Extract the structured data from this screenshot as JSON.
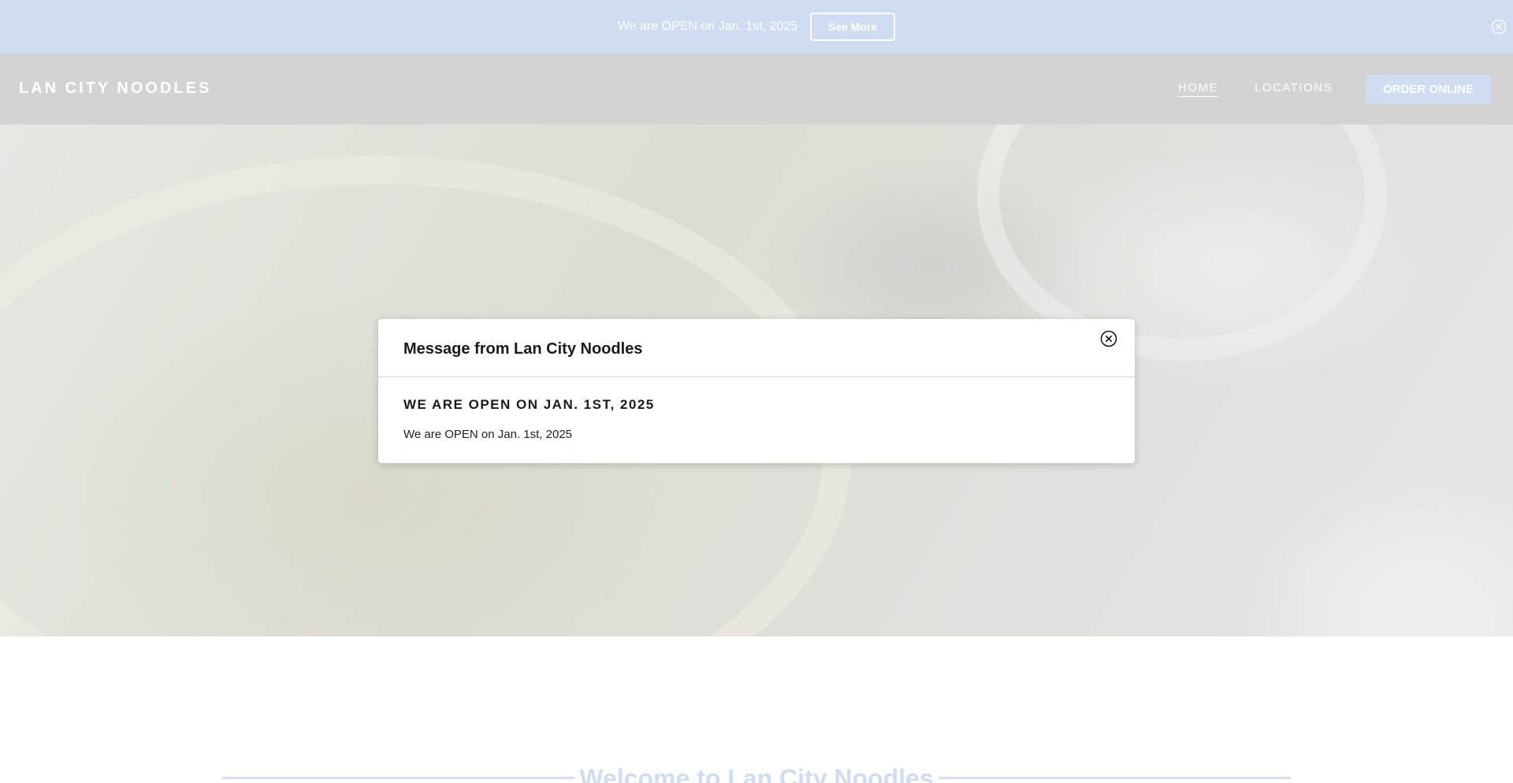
{
  "announcement": {
    "text": "We are OPEN on Jan. 1st, 2025",
    "button_label": "See More",
    "close_icon": "close-circle-icon"
  },
  "header": {
    "brand": "LAN CITY NOODLES",
    "nav": [
      {
        "label": "HOME",
        "active": true
      },
      {
        "label": "LOCATIONS",
        "active": false
      }
    ],
    "order_label": "ORDER ONLINE"
  },
  "modal": {
    "title": "Message from Lan City Noodles",
    "heading": "WE ARE OPEN ON JAN. 1ST, 2025",
    "body": "We are OPEN on Jan. 1st, 2025",
    "close_icon": "close-circle-icon"
  },
  "welcome": {
    "title": "Welcome to Lan City Noodles"
  },
  "colors": {
    "accent": "#cfdcf2",
    "header_bg": "#d3d3d3",
    "text_dark": "#1a1a1a"
  }
}
